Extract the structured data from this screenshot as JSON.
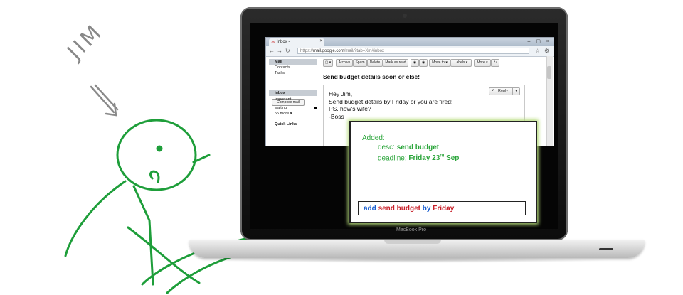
{
  "annotation": {
    "name": "JIM"
  },
  "laptop": {
    "brand": "MacBook Pro"
  },
  "browser": {
    "tab_title": "Inbox -",
    "url_prefix": "https://",
    "url_host": "mail.google.com",
    "url_path": "/mail/?tab=Xm#inbox"
  },
  "gmail": {
    "nav": [
      {
        "label": "Mail"
      },
      {
        "label": "Contacts"
      },
      {
        "label": "Tasks"
      }
    ],
    "compose_label": "Compose mail",
    "labels": [
      {
        "label": "Inbox"
      },
      {
        "label": "Important"
      },
      {
        "label": "waiting"
      },
      {
        "label": "55 more ▾"
      }
    ],
    "quick_links_label": "Quick Links",
    "toolbar": [
      {
        "label": "▢ ▾"
      },
      {
        "label": "Archive"
      },
      {
        "label": "Spam"
      },
      {
        "label": "Delete"
      },
      {
        "label": "Mark as read"
      },
      {
        "label": "◉"
      },
      {
        "label": "◉"
      },
      {
        "label": "Move to ▾"
      },
      {
        "label": "Labels ▾"
      },
      {
        "label": "More ▾"
      },
      {
        "label": "↻"
      }
    ],
    "subject": "Send budget details soon or else!",
    "reply_label": "Reply",
    "message_lines": [
      "Hey Jim,",
      "Send budget details by Friday or  you are fired!",
      "PS. how's wife?",
      "-Boss"
    ]
  },
  "panel": {
    "added_label": "Added:",
    "desc_label": "desc:",
    "desc_value": "send budget",
    "deadline_label": "deadline:",
    "deadline_value": "Friday 23",
    "deadline_suffix": "rd",
    "deadline_month": "Sep",
    "command": {
      "kw1": "add",
      "task": "send budget",
      "kw2": "by",
      "day": "Friday"
    }
  },
  "colors": {
    "sketch_green": "#1e9e3a",
    "keyword_blue": "#1a5fd1",
    "value_red": "#c8202a"
  }
}
